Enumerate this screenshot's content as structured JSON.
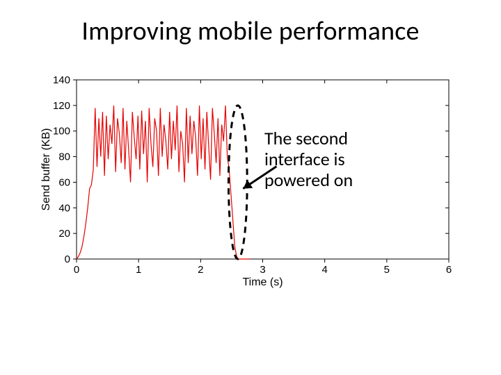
{
  "title": "Improving mobile performance",
  "annotation": {
    "line1": "The second",
    "line2": "interface is",
    "line3": "powered on"
  },
  "chart_data": {
    "type": "line",
    "title": "",
    "xlabel": "Time (s)",
    "ylabel": "Send buffer (KB)",
    "xlim": [
      0,
      6
    ],
    "ylim": [
      0,
      140
    ],
    "xticks": [
      0,
      1,
      2,
      3,
      4,
      5,
      6
    ],
    "yticks": [
      0,
      20,
      40,
      60,
      80,
      100,
      120,
      140
    ],
    "grid": false,
    "annotations": [
      {
        "text": "The second interface is powered on",
        "points_to_x": 2.55,
        "marker": "dashed-ellipse",
        "ellipse_x_range": [
          2.45,
          2.75
        ],
        "ellipse_y_range": [
          0,
          120
        ]
      }
    ],
    "series": [
      {
        "name": "Send buffer",
        "color": "#e60000",
        "x": [
          0.0,
          0.03,
          0.06,
          0.09,
          0.12,
          0.15,
          0.18,
          0.21,
          0.24,
          0.27,
          0.3,
          0.33,
          0.36,
          0.39,
          0.42,
          0.45,
          0.48,
          0.51,
          0.54,
          0.57,
          0.6,
          0.63,
          0.66,
          0.69,
          0.72,
          0.75,
          0.78,
          0.81,
          0.84,
          0.87,
          0.9,
          0.93,
          0.96,
          0.99,
          1.02,
          1.05,
          1.08,
          1.11,
          1.14,
          1.17,
          1.2,
          1.23,
          1.26,
          1.29,
          1.32,
          1.35,
          1.38,
          1.41,
          1.44,
          1.47,
          1.5,
          1.53,
          1.56,
          1.59,
          1.62,
          1.65,
          1.68,
          1.71,
          1.74,
          1.77,
          1.8,
          1.83,
          1.86,
          1.89,
          1.92,
          1.95,
          1.98,
          2.01,
          2.04,
          2.07,
          2.1,
          2.13,
          2.16,
          2.19,
          2.22,
          2.25,
          2.28,
          2.31,
          2.34,
          2.37,
          2.4,
          2.43,
          2.46,
          2.49,
          2.52,
          2.55,
          2.58,
          2.61,
          2.64,
          2.67,
          2.7,
          2.73,
          2.76,
          2.79
        ],
        "values": [
          0,
          2,
          5,
          10,
          18,
          28,
          40,
          55,
          58,
          70,
          118,
          72,
          110,
          80,
          115,
          65,
          112,
          78,
          105,
          90,
          120,
          68,
          110,
          98,
          75,
          118,
          70,
          108,
          85,
          60,
          115,
          95,
          78,
          112,
          70,
          116,
          82,
          108,
          60,
          118,
          90,
          72,
          110,
          100,
          65,
          118,
          80,
          105,
          92,
          70,
          115,
          78,
          108,
          85,
          120,
          68,
          100,
          90,
          60,
          118,
          75,
          112,
          82,
          108,
          95,
          65,
          120,
          78,
          110,
          70,
          115,
          88,
          62,
          118,
          98,
          75,
          110,
          65,
          105,
          92,
          120,
          80,
          70,
          50,
          30,
          10,
          2,
          0,
          0,
          0,
          0,
          0,
          0,
          0
        ]
      }
    ]
  }
}
